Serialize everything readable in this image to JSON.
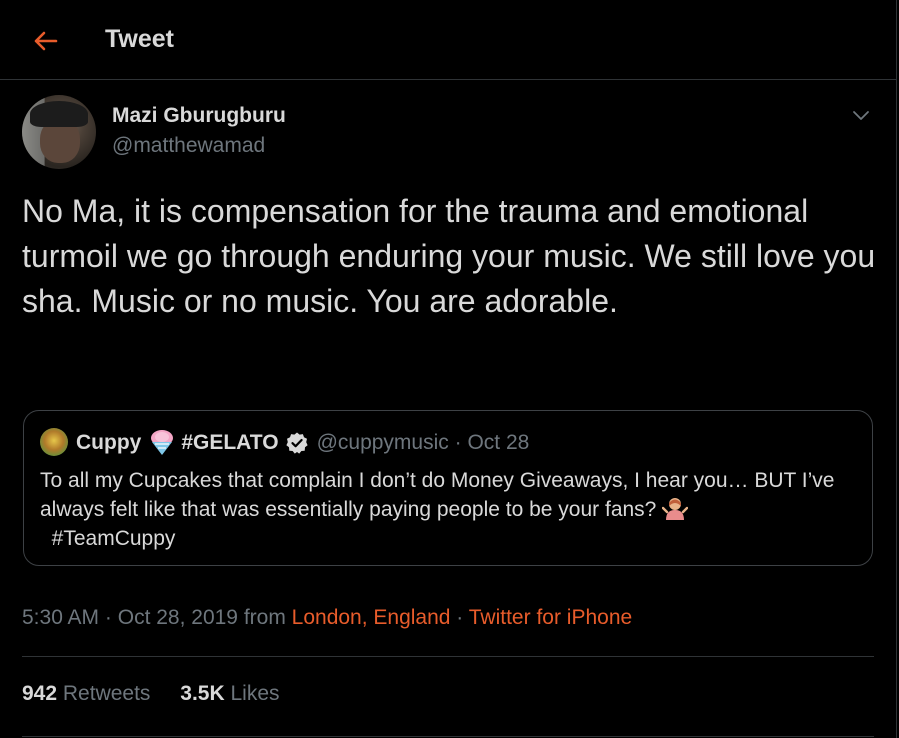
{
  "header": {
    "title": "Tweet",
    "back_icon": "arrow-left-icon",
    "accent_color": "#e85c2b"
  },
  "tweet": {
    "author_name": "Mazi Gburugburu",
    "author_handle": "@matthewamad",
    "text": "No Ma, it is compensation for the trauma and emotional turmoil we go through enduring your music. We still love you sha. Music or no music. You are adorable.",
    "menu_icon": "chevron-down-icon"
  },
  "quote": {
    "name": "Cuppy",
    "name_suffix": "#GELATO",
    "handle": "@cuppymusic",
    "separator": "·",
    "date": "Oct 28",
    "text": "To all my Cupcakes that complain I don’t do Money Giveaways, I hear you… BUT I’ve always felt like that was essentially paying people to be your fans?",
    "hashtag": "#TeamCuppy"
  },
  "meta": {
    "time": "5:30 AM",
    "sep1": " · ",
    "date": "Oct 28, 2019",
    "from": " from ",
    "location": "London, England",
    "sep2": " · ",
    "source": "Twitter for iPhone"
  },
  "stats": {
    "retweets_count": "942",
    "retweets_label": "Retweets",
    "likes_count": "3.5K",
    "likes_label": "Likes"
  }
}
